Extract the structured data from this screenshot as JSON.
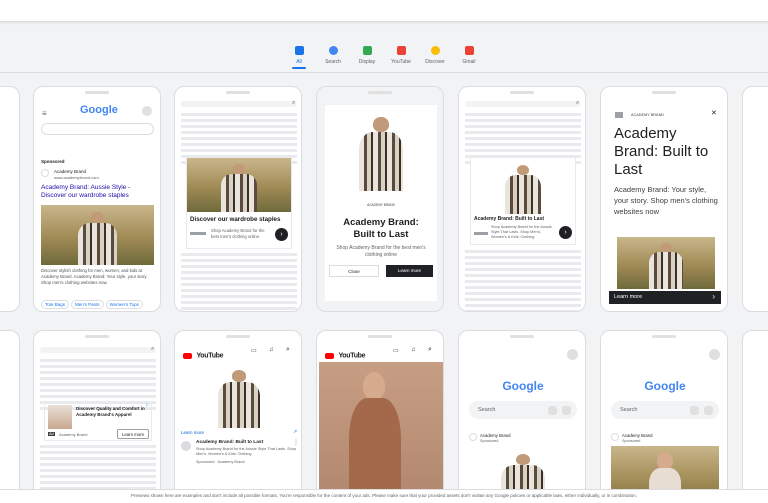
{
  "tabs": [
    {
      "label": "All",
      "color": "#1a73e8"
    },
    {
      "label": "Search",
      "color": "#4285f4"
    },
    {
      "label": "Display",
      "color": "#34a853"
    },
    {
      "label": "YouTube",
      "color": "#ea4335"
    },
    {
      "label": "Discover",
      "color": "#fbbc04"
    },
    {
      "label": "Gmail",
      "color": "#ea4335"
    }
  ],
  "search_ad": {
    "google": "Google",
    "sponsored": "Sponsored",
    "advertiser": "Academy Brand",
    "url": "www.academybrand.com",
    "headline": "Academy Brand: Aussie Style - Discover our wardrobe staples",
    "description": "Discover stylish clothing for men, women, and kids at Academy Brand. Academy Brand: Your style, your story. Shop men's clothing websites now.",
    "sitelinks": [
      "Tote Bags",
      "Men's Pants",
      "Women's Tops"
    ]
  },
  "display_ad_1": {
    "headline": "Discover our wardrobe staples",
    "body": "Shop Academy Brand for the best men's clothing online."
  },
  "interstitial": {
    "logo": "ACADEMY BRAND",
    "headline": "Academy Brand: Built to Last",
    "body": "Shop Academy Brand for the best men's clothing online",
    "close": "Close",
    "learn": "Learn more"
  },
  "display_ad_2": {
    "headline": "Academy Brand: Built to Last",
    "body": "Shop Academy Brand for the Aussie Style That Lasts. Shop Men's, Women's & Kids' Clothing"
  },
  "text_ad": {
    "logo": "ACADEMY BRAND",
    "headline": "Academy Brand: Built to Last",
    "body": "Academy Brand: Your style, your story. Shop men's clothing websites now",
    "cta": "Learn more"
  },
  "native_ad": {
    "headline": "Discover Quality and Comfort in Academy Brand's Apparel",
    "badge": "Ad",
    "advertiser": "Academy Brand",
    "cta": "Learn more"
  },
  "youtube_1": {
    "logo": "YouTube",
    "learn": "Learn more",
    "headline": "Academy Brand: Built to Last",
    "body": "Shop Academy Brand for the Aussie Style That Lasts. Shop Men's, Women's & Kids' Clothing",
    "sponsor": "Sponsored · Academy Brand"
  },
  "youtube_2": {
    "logo": "YouTube"
  },
  "discover_1": {
    "google": "Google",
    "search": "Search",
    "advertiser": "Academy Brand",
    "sponsored": "Sponsored"
  },
  "discover_2": {
    "google": "Google",
    "search": "Search",
    "advertiser": "Academy Brand",
    "sponsored": "Sponsored"
  },
  "footer": "Previews shown here are examples and don't include all possible formats. You're responsible for the content of your ads. Please make sure that your provided assets don't violate any Google policies or applicable laws, either individually, or in combination."
}
